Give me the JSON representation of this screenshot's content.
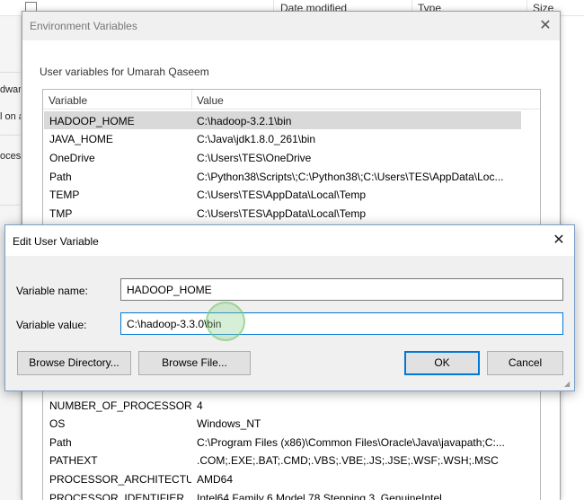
{
  "background": {
    "columns": [
      "Date modified",
      "Type",
      "Size"
    ],
    "left_fragments": [
      "dwar",
      "l on a",
      "ocess"
    ]
  },
  "env_dialog": {
    "title": "Environment Variables",
    "close_glyph": "✕",
    "user_group_label": "User variables for Umarah Qaseem",
    "headers": {
      "variable": "Variable",
      "value": "Value"
    },
    "user_vars": [
      {
        "name": "HADOOP_HOME",
        "value": "C:\\hadoop-3.2.1\\bin",
        "selected": true
      },
      {
        "name": "JAVA_HOME",
        "value": "C:\\Java\\jdk1.8.0_261\\bin"
      },
      {
        "name": "OneDrive",
        "value": "C:\\Users\\TES\\OneDrive"
      },
      {
        "name": "Path",
        "value": "C:\\Python38\\Scripts\\;C:\\Python38\\;C:\\Users\\TES\\AppData\\Loc..."
      },
      {
        "name": "TEMP",
        "value": "C:\\Users\\TES\\AppData\\Local\\Temp"
      },
      {
        "name": "TMP",
        "value": "C:\\Users\\TES\\AppData\\Local\\Temp"
      }
    ],
    "system_vars": [
      {
        "name": "NUMBER_OF_PROCESSORS",
        "value": "4"
      },
      {
        "name": "OS",
        "value": "Windows_NT"
      },
      {
        "name": "Path",
        "value": "C:\\Program Files (x86)\\Common Files\\Oracle\\Java\\javapath;C:..."
      },
      {
        "name": "PATHEXT",
        "value": ".COM;.EXE;.BAT;.CMD;.VBS;.VBE;.JS;.JSE;.WSF;.WSH;.MSC"
      },
      {
        "name": "PROCESSOR_ARCHITECTU...",
        "value": "AMD64"
      },
      {
        "name": "PROCESSOR_IDENTIFIER",
        "value": "Intel64 Family 6 Model 78 Stepping 3, GenuineIntel"
      }
    ]
  },
  "edit_dialog": {
    "title": "Edit User Variable",
    "close_glyph": "✕",
    "name_label": "Variable name:",
    "name_value": "HADOOP_HOME",
    "value_label": "Variable value:",
    "value_value": "C:\\hadoop-3.3.0\\bin",
    "browse_directory": "Browse Directory...",
    "browse_file": "Browse File...",
    "ok": "OK",
    "cancel": "Cancel"
  },
  "colors": {
    "accent": "#0078d7",
    "selection": "#d9d9d9",
    "cursor_highlight": "#90d28c"
  }
}
